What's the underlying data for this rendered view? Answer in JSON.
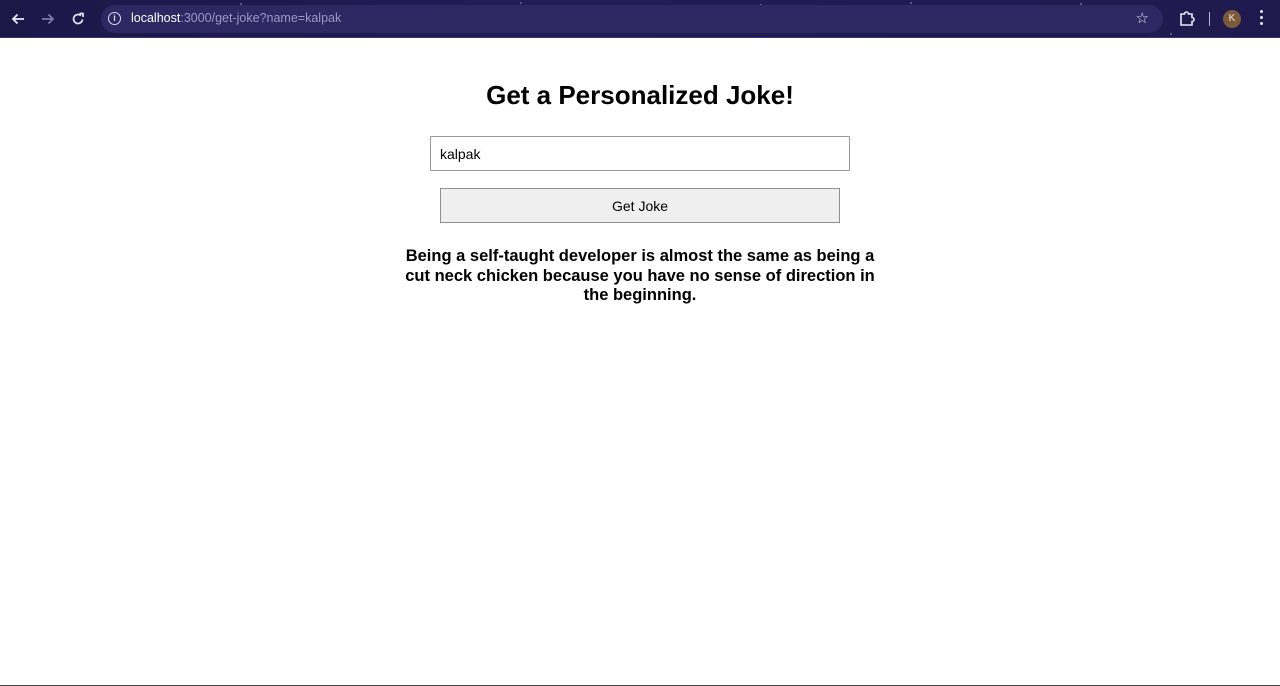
{
  "browser": {
    "url_host": "localhost",
    "url_rest": ":3000/get-joke?name=kalpak",
    "avatar_initial": "K"
  },
  "icons": {
    "back": "arrow-left-icon",
    "forward": "arrow-right-icon",
    "reload": "reload-icon",
    "site_info": "info-icon",
    "bookmark": "star-icon",
    "extensions": "puzzle-icon",
    "menu": "kebab-menu-icon"
  },
  "page": {
    "title": "Get a Personalized Joke!",
    "name_input_value": "kalpak",
    "button_label": "Get Joke",
    "joke_text": "Being a self-taught developer is almost the same as being a cut neck chicken because you have no sense of direction in the beginning."
  }
}
